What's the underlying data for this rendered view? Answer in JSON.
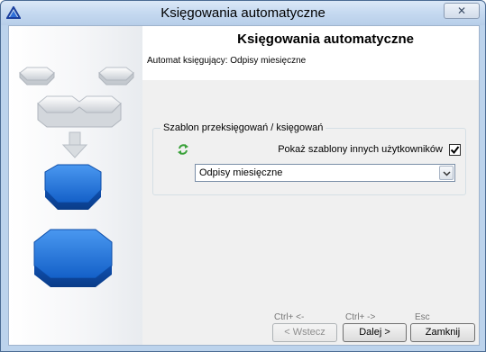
{
  "window": {
    "title": "Księgowania automatyczne"
  },
  "header": {
    "title": "Księgowania automatyczne",
    "subtitle": "Automat księgujący: Odpisy miesięczne"
  },
  "group": {
    "label": "Szablon przeksięgowań / księgowań",
    "show_other_users_label": "Pokaż szablony innych użytkowników",
    "show_other_users_checked": true,
    "template_select_value": "Odpisy miesięczne"
  },
  "footer": {
    "back_hint": "Ctrl+ <-",
    "next_hint": "Ctrl+ ->",
    "close_hint": "Esc",
    "back_label": "< Wstecz",
    "next_label": "Dalej >",
    "close_label": "Zamknij"
  },
  "icons": {
    "app": "triangle-logo-icon",
    "refresh": "refresh-icon",
    "close": "close-icon",
    "dropdown": "chevron-down-icon"
  },
  "colors": {
    "accent_blue": "#1f6fd6",
    "title_bar": "#c5d9f0",
    "refresh_green": "#3aa13a"
  }
}
